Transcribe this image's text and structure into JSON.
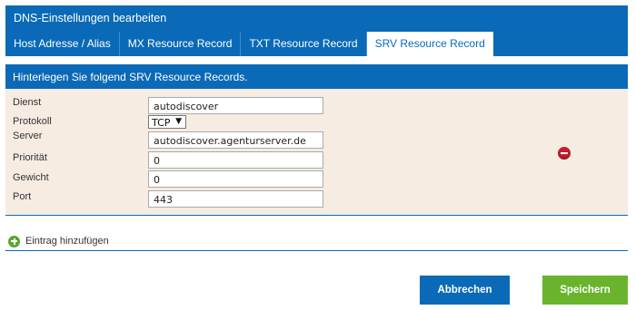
{
  "dialog": {
    "title": "DNS-Einstellungen bearbeiten"
  },
  "tabs": [
    {
      "label": "Host Adresse / Alias",
      "active": false
    },
    {
      "label": "MX Resource Record",
      "active": false
    },
    {
      "label": "TXT Resource Record",
      "active": false
    },
    {
      "label": "SRV Resource Record",
      "active": true
    }
  ],
  "section": {
    "header": "Hinterlegen Sie folgend SRV Resource Records."
  },
  "record": {
    "dienst": {
      "label": "Dienst",
      "value": "autodiscover"
    },
    "protokoll": {
      "label": "Protokoll",
      "value": "TCP"
    },
    "server": {
      "label": "Server",
      "value": "autodiscover.agenturserver.de"
    },
    "prioritaet": {
      "label": "Priorität",
      "value": "0"
    },
    "gewicht": {
      "label": "Gewicht",
      "value": "0"
    },
    "port": {
      "label": "Port",
      "value": "443"
    }
  },
  "add_entry": {
    "label": "Eintrag hinzufügen"
  },
  "buttons": {
    "cancel": "Abbrechen",
    "save": "Speichern"
  },
  "colors": {
    "primary": "#0a6ab8",
    "panel": "#f6ece2",
    "save": "#6ab42d",
    "remove": "#c41f2e",
    "add": "#5aa72d"
  }
}
